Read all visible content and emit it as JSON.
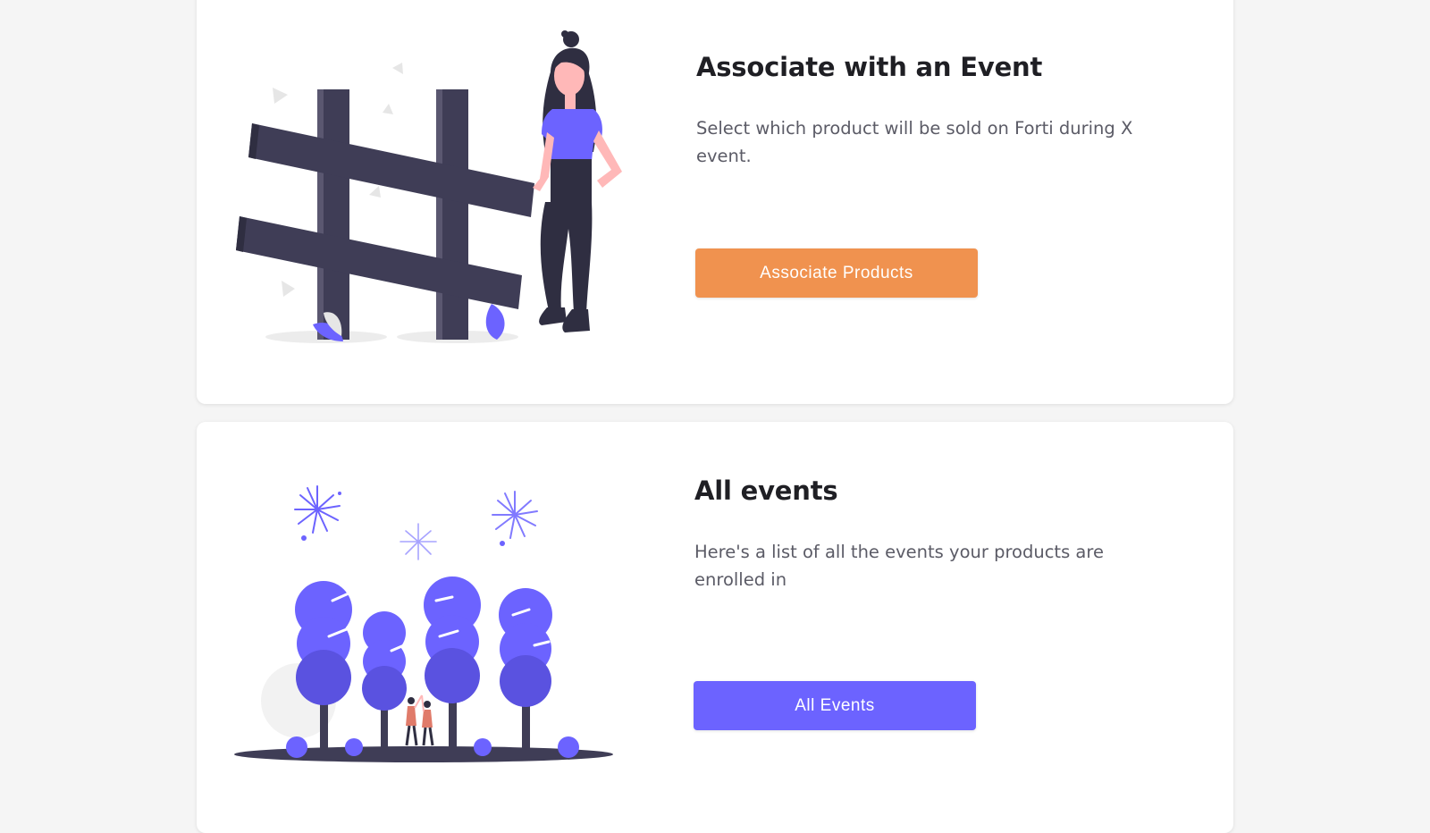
{
  "associate_card": {
    "title": "Associate with an Event",
    "description": "Select which product will be sold on Forti during X event.",
    "button_label": "Associate Products",
    "button_color": "#f0924f",
    "illustration": "hashtag-woman-illustration"
  },
  "events_card": {
    "title": "All events",
    "description": "Here's a list of all the events your products are enrolled in",
    "button_label": "All Events",
    "button_color": "#6c63ff",
    "illustration": "fireworks-trees-illustration"
  },
  "colors": {
    "accent_purple": "#6c63ff",
    "accent_orange": "#f0924f",
    "dark_figure": "#3f3d56",
    "skin": "#ffb8b8"
  }
}
